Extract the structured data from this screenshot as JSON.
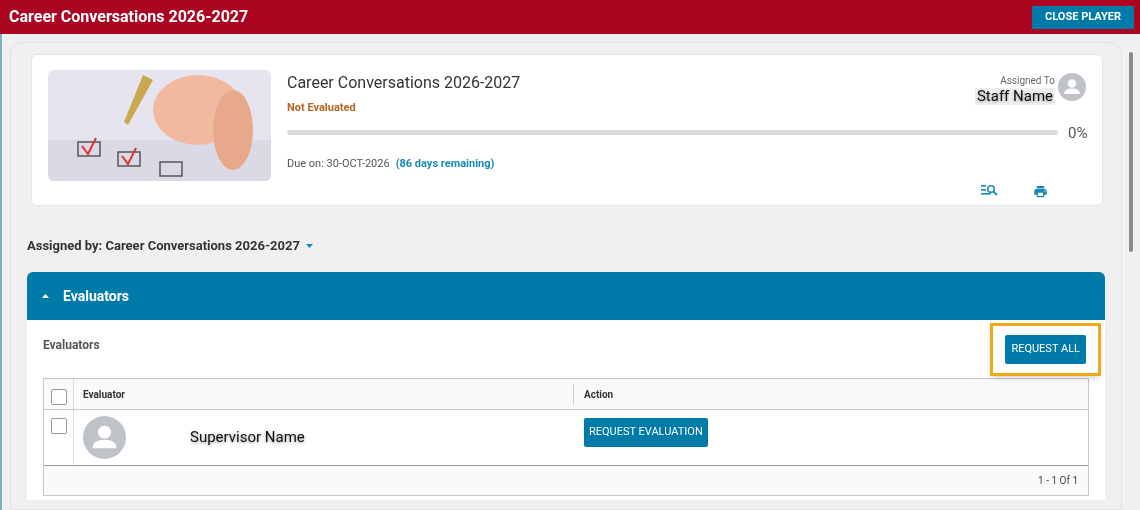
{
  "header": {
    "title": "Career Conversations 2026-2027",
    "close_button": "CLOSE PLAYER"
  },
  "card": {
    "title": "Career Conversations 2026-2027",
    "status": "Not Evaluated",
    "progress": {
      "level": 0,
      "reading": "0%"
    },
    "due_label": "Due on:",
    "due_date": "30-OCT-2026",
    "remaining": "(86 days remaining)",
    "assigned_to_label": "Assigned To",
    "assigned_to": "Staff Name"
  },
  "assigned_by": "Assigned by: Career Conversations 2026-2027",
  "section": {
    "title": "Evaluators",
    "expanded": true,
    "subtitle": "Evaluators",
    "request_all": {
      "label": "REQUEST ALL",
      "highlighted": true
    },
    "table": {
      "select_all_checked": false,
      "columns": [
        "Evaluator",
        "Action"
      ],
      "rows": [
        {
          "checked": false,
          "name": "Supervisor Name",
          "action": "REQUEST EVALUATION"
        }
      ],
      "footer": "1 - 1 Of 1"
    }
  }
}
